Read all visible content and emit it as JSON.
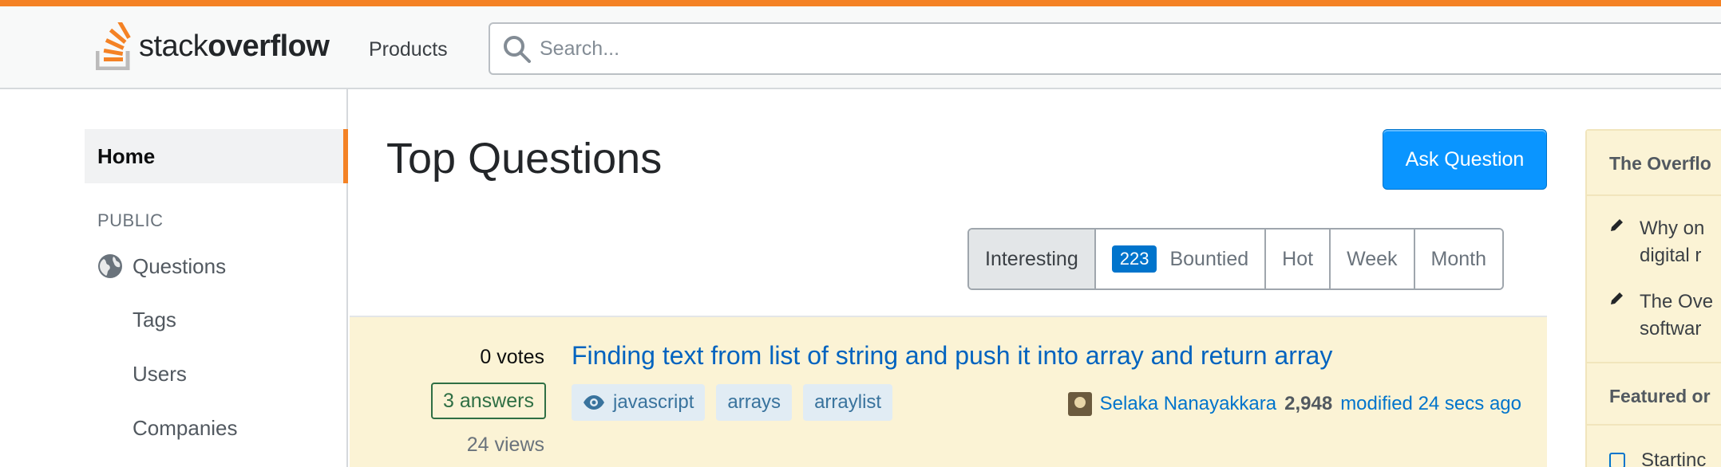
{
  "header": {
    "logo_text_light": "stack",
    "logo_text_bold": "overflow",
    "products_label": "Products",
    "search_placeholder": "Search..."
  },
  "sidebar": {
    "home_label": "Home",
    "section_label": "PUBLIC",
    "questions_label": "Questions",
    "tags_label": "Tags",
    "users_label": "Users",
    "companies_label": "Companies"
  },
  "main": {
    "title": "Top Questions",
    "ask_button": "Ask Question",
    "filters": {
      "interesting": "Interesting",
      "bounty_count": "223",
      "bountied": "Bountied",
      "hot": "Hot",
      "week": "Week",
      "month": "Month"
    }
  },
  "question": {
    "votes_count": "0",
    "votes_label": "votes",
    "answers": "3 answers",
    "views": "24 views",
    "title": "Finding text from list of string and push it into array and return array",
    "tags": [
      "javascript",
      "arrays",
      "arraylist"
    ],
    "user_name": "Selaka Nanayakkara",
    "user_rep": "2,948",
    "modified": "modified 24 secs ago"
  },
  "widget": {
    "heading": "The Overflo",
    "item1_line1": "Why on",
    "item1_line2": "digital r",
    "item2_line1": "The Ove",
    "item2_line2": "softwar",
    "featured_heading": "Featured or",
    "featured_item": "Startinc"
  },
  "colors": {
    "accent": "#f48225",
    "primary_button": "#0a95ff",
    "link": "#0063bf",
    "highlight_row": "#fbf3d5"
  }
}
